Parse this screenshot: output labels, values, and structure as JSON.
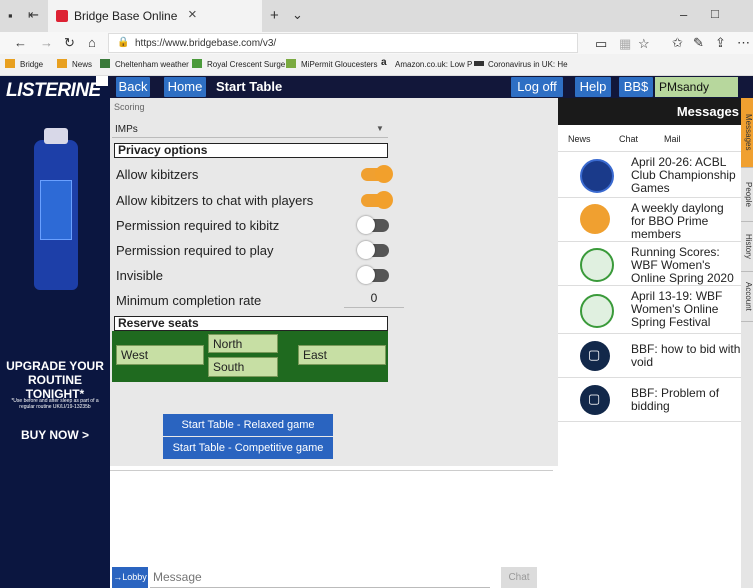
{
  "browser": {
    "tab_title": "Bridge Base Online",
    "url": "https://www.bridgebase.com/v3/",
    "bookmarks": [
      "Bridge",
      "News",
      "Cheltenham weather",
      "Royal Crescent Surge",
      "MiPermit Gloucesters",
      "Amazon.co.uk: Low P",
      "Coronavirus in UK: He"
    ]
  },
  "ad": {
    "brand": "LISTERINE",
    "headline": "UPGRADE YOUR ROUTINE TONIGHT*",
    "fineprint": "*Use before and after sleep as part of a regular routine UK/LI/19-13235b",
    "cta": "BUY NOW >"
  },
  "topbar": {
    "back": "Back",
    "home": "Home",
    "title": "Start Table",
    "logoff": "Log off",
    "help": "Help",
    "bbs": "BB$",
    "username": "PMsandy"
  },
  "scoring": {
    "label": "Scoring",
    "value": "IMPs"
  },
  "privacy": {
    "heading": "Privacy options",
    "options": [
      {
        "label": "Allow kibitzers",
        "on": true
      },
      {
        "label": "Allow kibitzers to chat with players",
        "on": true
      },
      {
        "label": "Permission required to kibitz",
        "on": false
      },
      {
        "label": "Permission required to play",
        "on": false
      },
      {
        "label": "Invisible",
        "on": false
      }
    ],
    "min_completion_label": "Minimum completion rate",
    "min_completion_value": "0"
  },
  "reserve": {
    "heading": "Reserve seats",
    "north": "North",
    "south": "South",
    "east": "East",
    "west": "West"
  },
  "buttons": {
    "relaxed": "Start Table - Relaxed game",
    "competitive": "Start Table - Competitive game"
  },
  "chat": {
    "lobby": "→Lobby",
    "placeholder": "Message",
    "send": "Chat"
  },
  "messages": {
    "header": "Messages",
    "tabs": [
      "News",
      "Chat",
      "Mail"
    ],
    "items": [
      {
        "text": "April 20-26: ACBL Club Championship Games",
        "icon": "acbl-logo-icon"
      },
      {
        "text": "A weekly daylong for BBO Prime members",
        "icon": "bbo-prime-icon"
      },
      {
        "text": "Running Scores: WBF Women's Online Spring 2020",
        "icon": "wbf-logo-icon"
      },
      {
        "text": "April 13-19: WBF Women's Online Spring Festival",
        "icon": "wbf-logo-icon"
      },
      {
        "text": "BBF: how to bid with void",
        "icon": "chat-bubble-icon"
      },
      {
        "text": "BBF: Problem of bidding",
        "icon": "chat-bubble-icon"
      }
    ]
  },
  "sidetabs": [
    "Messages",
    "People",
    "History",
    "Account"
  ],
  "colors": {
    "topbar": "#12173a",
    "button_blue": "#2e6fc4",
    "toggle_on": "#f0a030",
    "seat_green": "#1f6a1f"
  }
}
